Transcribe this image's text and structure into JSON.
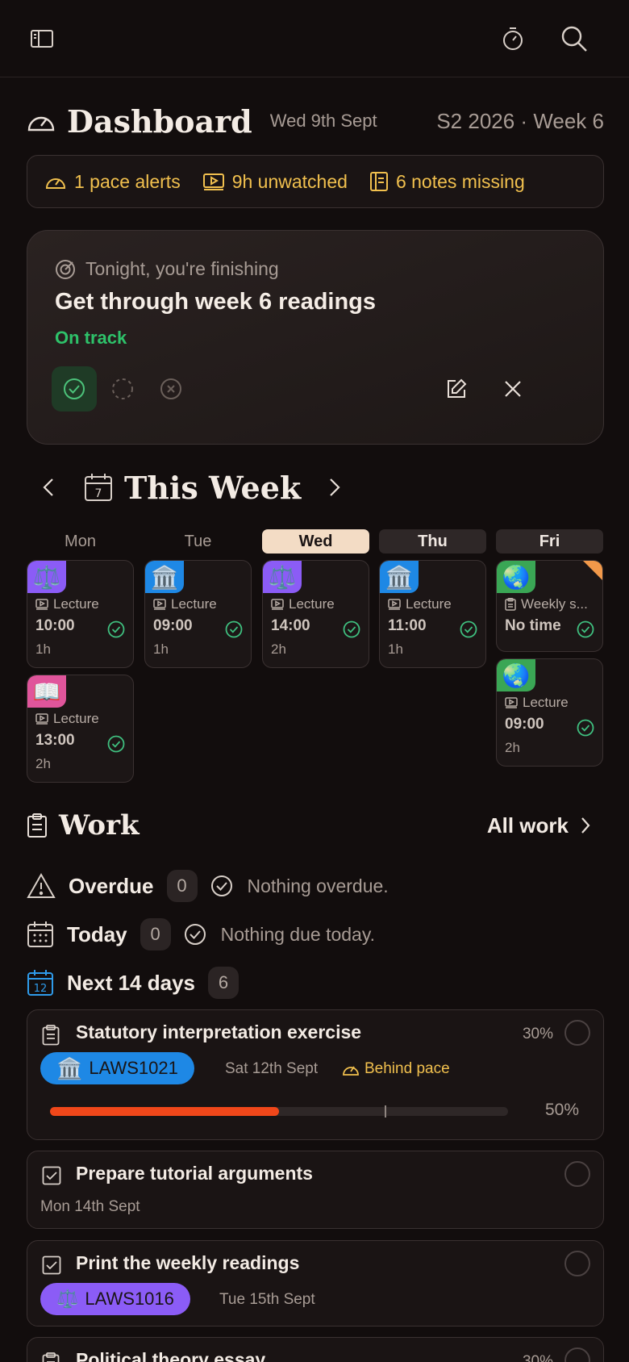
{
  "header": {
    "title": "Dashboard",
    "date": "Wed 9th Sept",
    "term": "S2 2026 · Week 6"
  },
  "alerts": {
    "pace": "1 pace alerts",
    "unwatched": "9h unwatched",
    "notes": "6 notes missing"
  },
  "goal": {
    "subtitle": "Tonight, you're finishing",
    "title": "Get through week 6 readings",
    "status": "On track"
  },
  "week": {
    "title": "This Week",
    "days": [
      {
        "label": "Mon",
        "events": [
          {
            "emoji": "⚖️",
            "color": "#8b5cf6",
            "kind": "Lecture",
            "time": "10:00",
            "duration": "1h"
          },
          {
            "emoji": "📖",
            "color": "#e0559b",
            "kind": "Lecture",
            "time": "13:00",
            "duration": "2h"
          }
        ]
      },
      {
        "label": "Tue",
        "events": [
          {
            "emoji": "🏛️",
            "color": "#1e88e5",
            "kind": "Lecture",
            "time": "09:00",
            "duration": "1h"
          }
        ]
      },
      {
        "label": "Wed",
        "events": [
          {
            "emoji": "⚖️",
            "color": "#8b5cf6",
            "kind": "Lecture",
            "time": "14:00",
            "duration": "2h"
          }
        ]
      },
      {
        "label": "Thu",
        "events": [
          {
            "emoji": "🏛️",
            "color": "#1e88e5",
            "kind": "Lecture",
            "time": "11:00",
            "duration": "1h"
          }
        ]
      },
      {
        "label": "Fri",
        "events": [
          {
            "emoji": "🌏",
            "color": "#3aa655",
            "kind": "Weekly s...",
            "time": "No time",
            "duration": ""
          },
          {
            "emoji": "🌏",
            "color": "#3aa655",
            "kind": "Lecture",
            "time": "09:00",
            "duration": "2h"
          }
        ]
      }
    ]
  },
  "work": {
    "title": "Work",
    "all_work": "All work",
    "overdue": {
      "label": "Overdue",
      "count": "0",
      "message": "Nothing overdue."
    },
    "today": {
      "label": "Today",
      "count": "0",
      "message": "Nothing due today."
    },
    "next": {
      "label": "Next 14 days",
      "count": "6"
    },
    "calendar_day": "12",
    "tasks": [
      {
        "title": "Statutory interpretation exercise",
        "weight": "30%",
        "course": "LAWS1021",
        "course_emoji": "🏛️",
        "course_color": "#1e88e5",
        "due": "Sat 12th Sept",
        "flag": "Behind pace",
        "progress": 0.5,
        "progress_label": "50%",
        "pace_marker": 0.73
      },
      {
        "title": "Prepare tutorial arguments",
        "due": "Mon 14th Sept"
      },
      {
        "title": "Print the weekly readings",
        "course": "LAWS1016",
        "course_emoji": "⚖️",
        "course_color": "#8b5cf6",
        "due": "Tue 15th Sept"
      },
      {
        "title": "Political theory essay",
        "weight": "30%"
      }
    ]
  }
}
